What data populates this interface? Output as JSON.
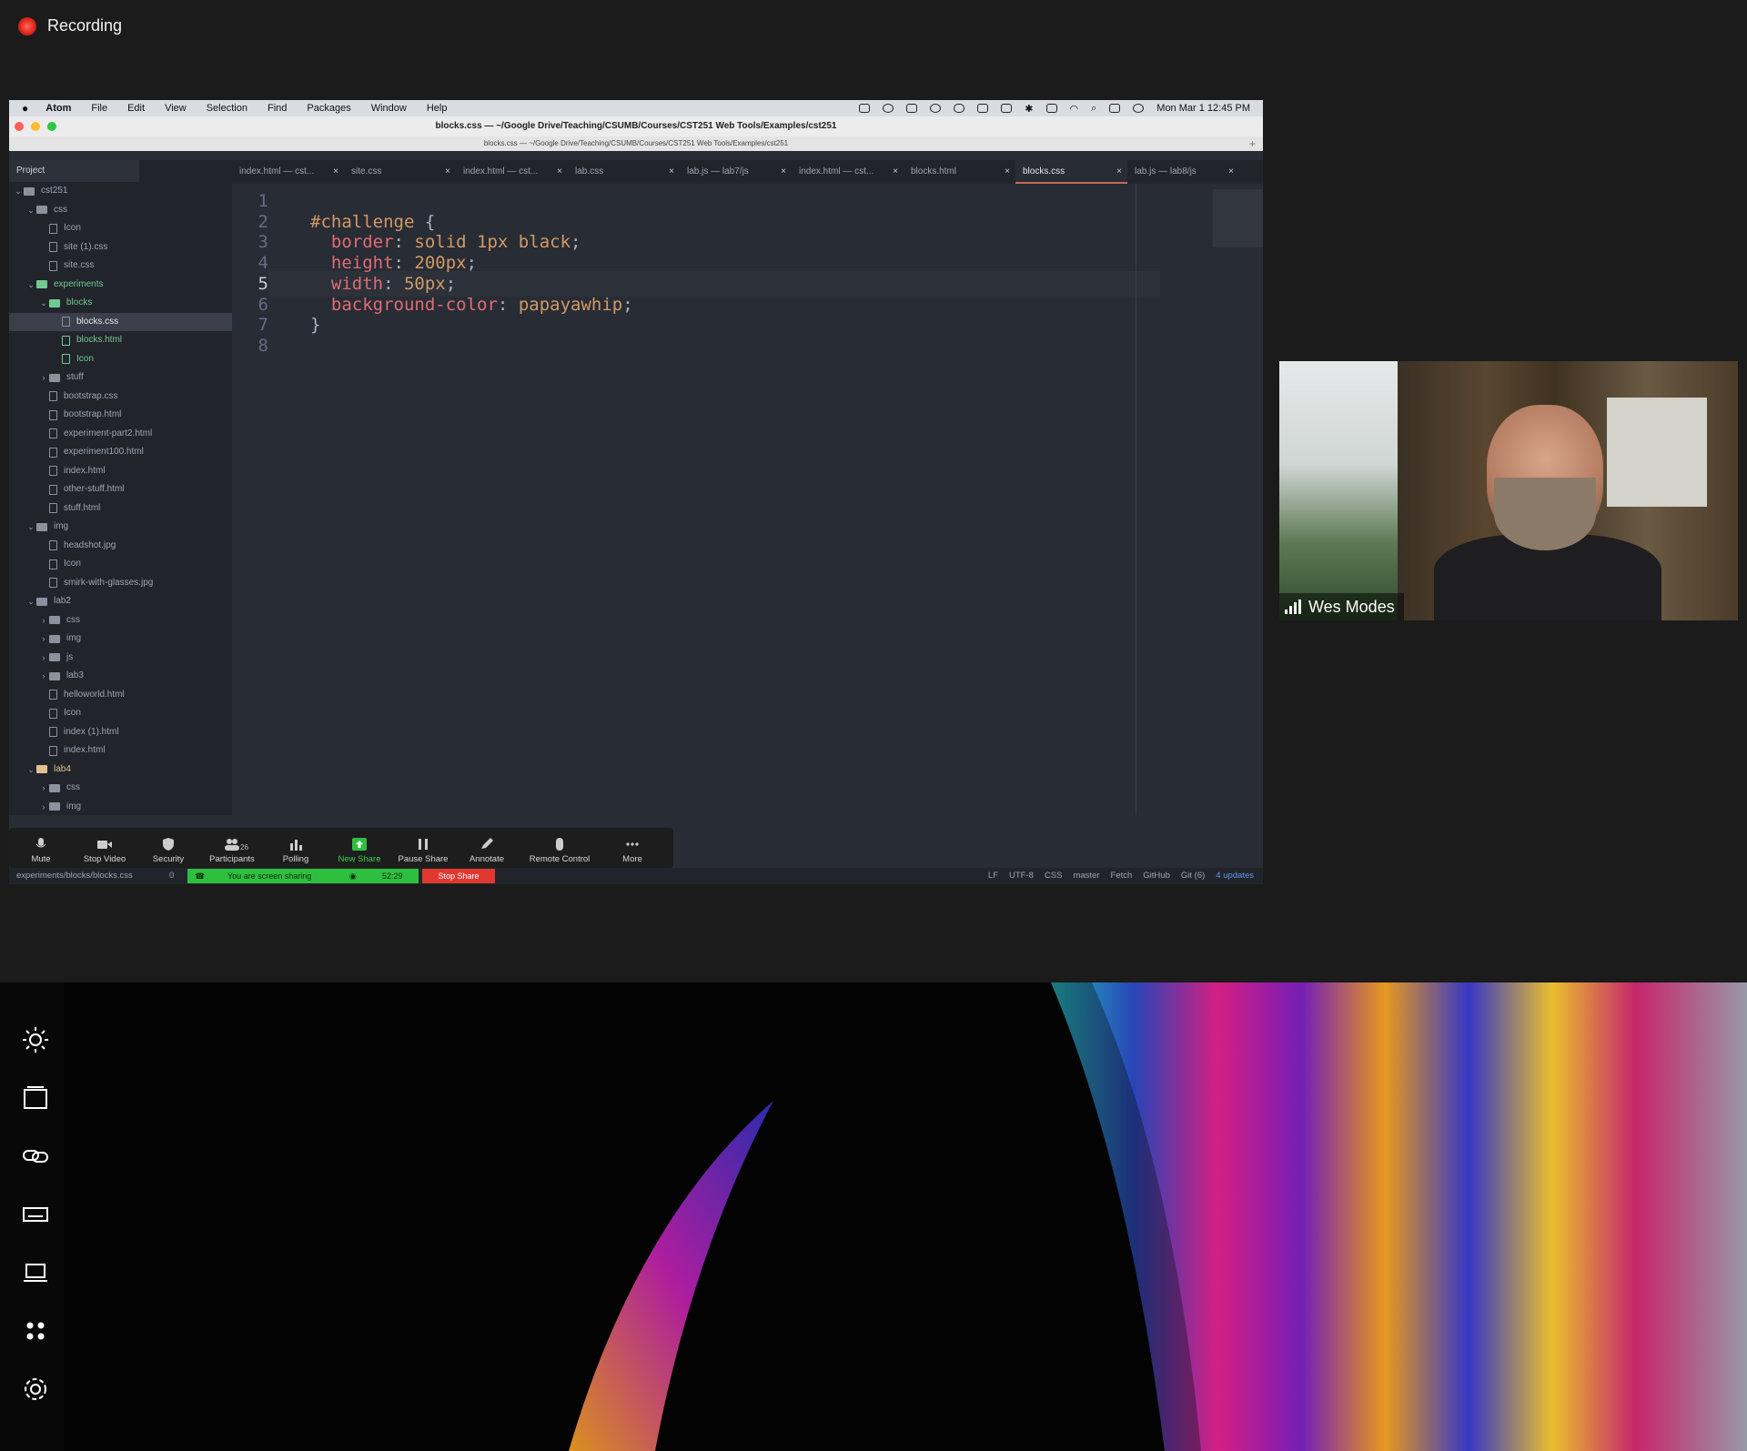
{
  "recording": {
    "label": "Recording"
  },
  "menubar": {
    "app": "Atom",
    "items": [
      "File",
      "Edit",
      "View",
      "Selection",
      "Find",
      "Packages",
      "Window",
      "Help"
    ],
    "clock": "Mon Mar 1  12:45 PM"
  },
  "window": {
    "title": "blocks.css — ~/Google Drive/Teaching/CSUMB/Courses/CST251 Web Tools/Examples/cst251",
    "path": "blocks.css — ~/Google Drive/Teaching/CSUMB/Courses/CST251 Web Tools/Examples/cst251"
  },
  "sidebar": {
    "header": "Project",
    "tree": [
      {
        "label": "cst251",
        "kind": "root",
        "indent": 0,
        "chev": "v"
      },
      {
        "label": "css",
        "kind": "folder",
        "indent": 1,
        "chev": "v"
      },
      {
        "label": "Icon",
        "kind": "file",
        "indent": 2
      },
      {
        "label": "site (1).css",
        "kind": "file",
        "indent": 2
      },
      {
        "label": "site.css",
        "kind": "file",
        "indent": 2
      },
      {
        "label": "experiments",
        "kind": "folder",
        "indent": 1,
        "chev": "v",
        "color": "green"
      },
      {
        "label": "blocks",
        "kind": "folder",
        "indent": 2,
        "chev": "v",
        "color": "green"
      },
      {
        "label": "blocks.css",
        "kind": "file",
        "indent": 3,
        "selected": true
      },
      {
        "label": "blocks.html",
        "kind": "file",
        "indent": 3,
        "color": "green"
      },
      {
        "label": "Icon",
        "kind": "file",
        "indent": 3,
        "color": "green"
      },
      {
        "label": "stuff",
        "kind": "folder",
        "indent": 2,
        "chev": ">"
      },
      {
        "label": "bootstrap.css",
        "kind": "file",
        "indent": 2
      },
      {
        "label": "bootstrap.html",
        "kind": "file",
        "indent": 2
      },
      {
        "label": "experiment-part2.html",
        "kind": "file",
        "indent": 2
      },
      {
        "label": "experiment100.html",
        "kind": "file",
        "indent": 2
      },
      {
        "label": "index.html",
        "kind": "file",
        "indent": 2
      },
      {
        "label": "other-stuff.html",
        "kind": "file",
        "indent": 2
      },
      {
        "label": "stuff.html",
        "kind": "file",
        "indent": 2
      },
      {
        "label": "img",
        "kind": "folder",
        "indent": 1,
        "chev": "v"
      },
      {
        "label": "headshot.jpg",
        "kind": "file",
        "indent": 2
      },
      {
        "label": "Icon",
        "kind": "file",
        "indent": 2
      },
      {
        "label": "smirk-with-glasses.jpg",
        "kind": "file",
        "indent": 2
      },
      {
        "label": "lab2",
        "kind": "folder",
        "indent": 1,
        "chev": "v"
      },
      {
        "label": "css",
        "kind": "folder",
        "indent": 2,
        "chev": ">"
      },
      {
        "label": "img",
        "kind": "folder",
        "indent": 2,
        "chev": ">"
      },
      {
        "label": "js",
        "kind": "folder",
        "indent": 2,
        "chev": ">"
      },
      {
        "label": "lab3",
        "kind": "folder",
        "indent": 2,
        "chev": ">"
      },
      {
        "label": "helloworld.html",
        "kind": "file",
        "indent": 2
      },
      {
        "label": "Icon",
        "kind": "file",
        "indent": 2
      },
      {
        "label": "index (1).html",
        "kind": "file",
        "indent": 2
      },
      {
        "label": "index.html",
        "kind": "file",
        "indent": 2
      },
      {
        "label": "lab4",
        "kind": "folder",
        "indent": 1,
        "chev": "v",
        "color": "yellow"
      },
      {
        "label": "css",
        "kind": "folder",
        "indent": 2,
        "chev": ">"
      },
      {
        "label": "img",
        "kind": "folder",
        "indent": 2,
        "chev": ">"
      }
    ]
  },
  "tabs": [
    {
      "label": "index.html — cst...",
      "active": false
    },
    {
      "label": "site.css",
      "active": false
    },
    {
      "label": "index.html — cst...",
      "active": false
    },
    {
      "label": "lab.css",
      "active": false
    },
    {
      "label": "lab.js — lab7/js",
      "active": false
    },
    {
      "label": "index.html — cst...",
      "active": false
    },
    {
      "label": "blocks.html",
      "active": false
    },
    {
      "label": "blocks.css",
      "active": true
    },
    {
      "label": "lab.js — lab8/js",
      "active": false
    }
  ],
  "editor": {
    "line_numbers": [
      "1",
      "2",
      "3",
      "4",
      "5",
      "6",
      "7",
      "8"
    ],
    "selector": "#challenge",
    "open_brace": "{",
    "close_brace": "}",
    "rules": [
      {
        "prop": "border",
        "value": "solid 1px black"
      },
      {
        "prop": "height",
        "value": "200px"
      },
      {
        "prop": "width",
        "value": "50px"
      },
      {
        "prop": "background-color",
        "value": "papayawhip"
      }
    ],
    "current_line": 5
  },
  "zoom_toolbar": {
    "buttons": [
      "Mute",
      "Stop Video",
      "Security",
      "Participants",
      "Polling",
      "New Share",
      "Pause Share",
      "Annotate",
      "Remote Control",
      "More"
    ],
    "participant_count": "26"
  },
  "statusbar": {
    "file": "experiments/blocks/blocks.css",
    "issues": "0",
    "sharing_text": "You are screen sharing",
    "timer": "52:29",
    "stop_share": "Stop Share",
    "items": [
      "LF",
      "UTF-8",
      "CSS",
      "master",
      "Fetch",
      "GitHub",
      "Git (6)",
      "4 updates"
    ]
  },
  "video": {
    "name": "Wes Modes"
  },
  "colors": {
    "recording": "#e0281e",
    "share_green": "#2fbf3f",
    "stop_red": "#e0382e",
    "code_prop": "#e06c75",
    "code_value": "#d19a66"
  }
}
